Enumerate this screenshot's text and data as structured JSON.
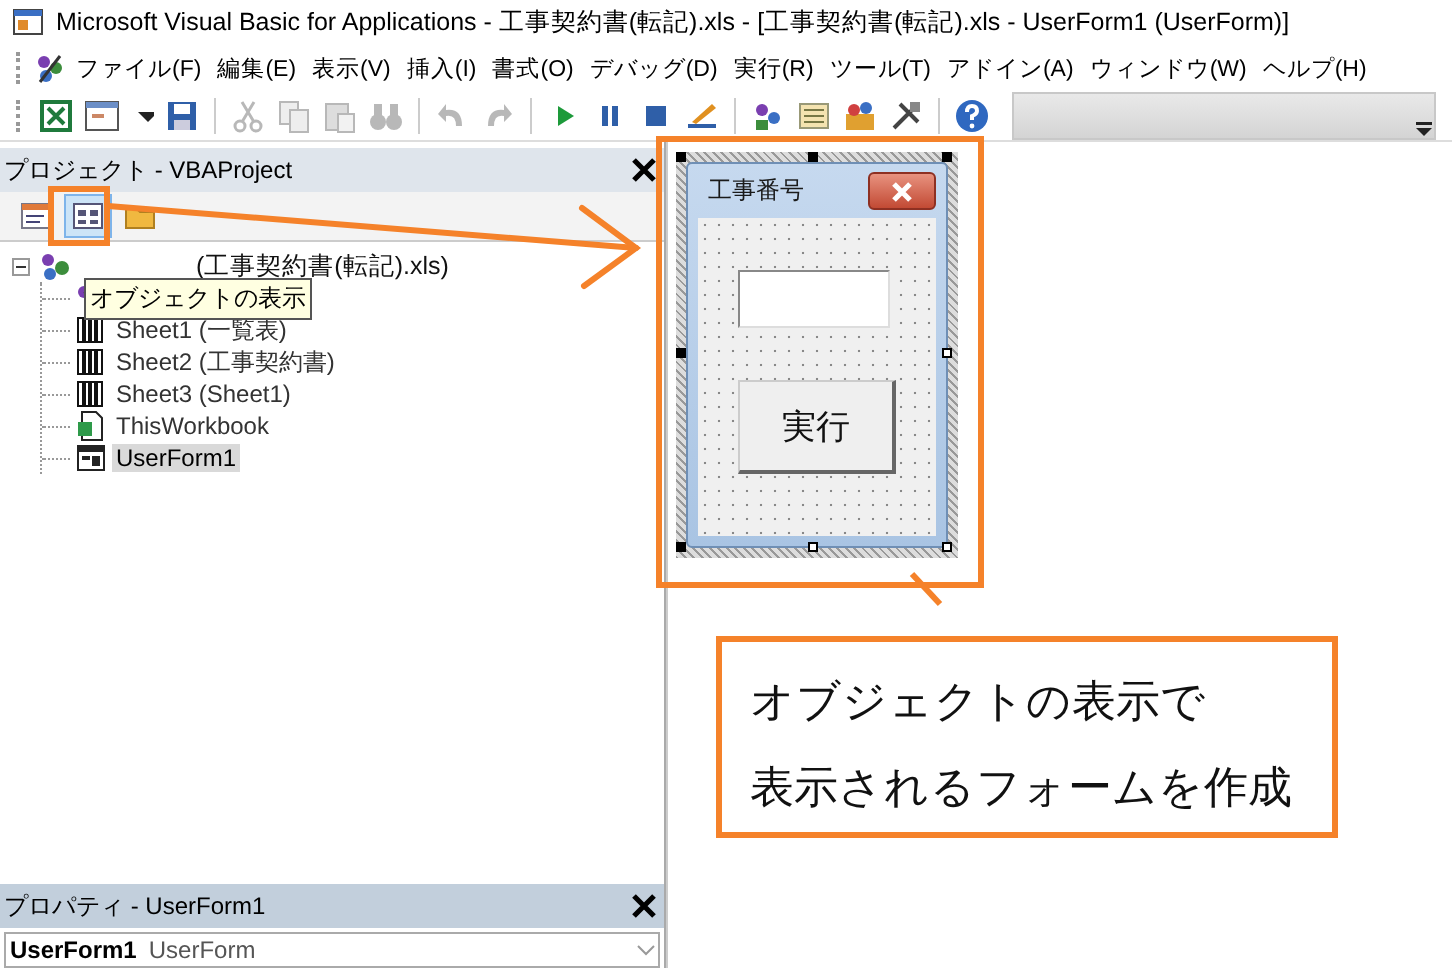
{
  "window": {
    "title": "Microsoft Visual Basic for Applications - 工事契約書(転記).xls - [工事契約書(転記).xls - UserForm1 (UserForm)]"
  },
  "menu": [
    "ファイル(F)",
    "編集(E)",
    "表示(V)",
    "挿入(I)",
    "書式(O)",
    "デバッグ(D)",
    "実行(R)",
    "ツール(T)",
    "アドイン(A)",
    "ウィンドウ(W)",
    "ヘルプ(H)"
  ],
  "project": {
    "title": "プロジェクト - VBAProject",
    "view_buttons": [
      {
        "kind": "code",
        "selected": false
      },
      {
        "kind": "object",
        "selected": true
      },
      {
        "kind": "folder",
        "selected": false
      }
    ],
    "tooltip": "オブジェクトの表示",
    "tree": {
      "label": "(工事契約書(転記).xls)",
      "expanded": true,
      "children": [
        {
          "kind": "module"
        },
        {
          "label": "Sheet1 (一覧表)",
          "kind": "sheet",
          "selected": false
        },
        {
          "label": "Sheet2 (工事契約書)",
          "kind": "sheet",
          "selected": false
        },
        {
          "label": "Sheet3 (Sheet1)",
          "kind": "sheet",
          "selected": false
        },
        {
          "label": "ThisWorkbook",
          "kind": "workbook",
          "selected": false
        },
        {
          "label": "UserForm1",
          "kind": "form",
          "selected": true
        }
      ]
    }
  },
  "properties": {
    "title": "プロパティ - UserForm1",
    "object_name": "UserForm1",
    "object_type": "UserForm"
  },
  "form": {
    "caption": "工事番号",
    "button": "実行"
  },
  "callout": {
    "lines": [
      "オブジェクトの表示で",
      "表示されるフォームを作成"
    ]
  }
}
